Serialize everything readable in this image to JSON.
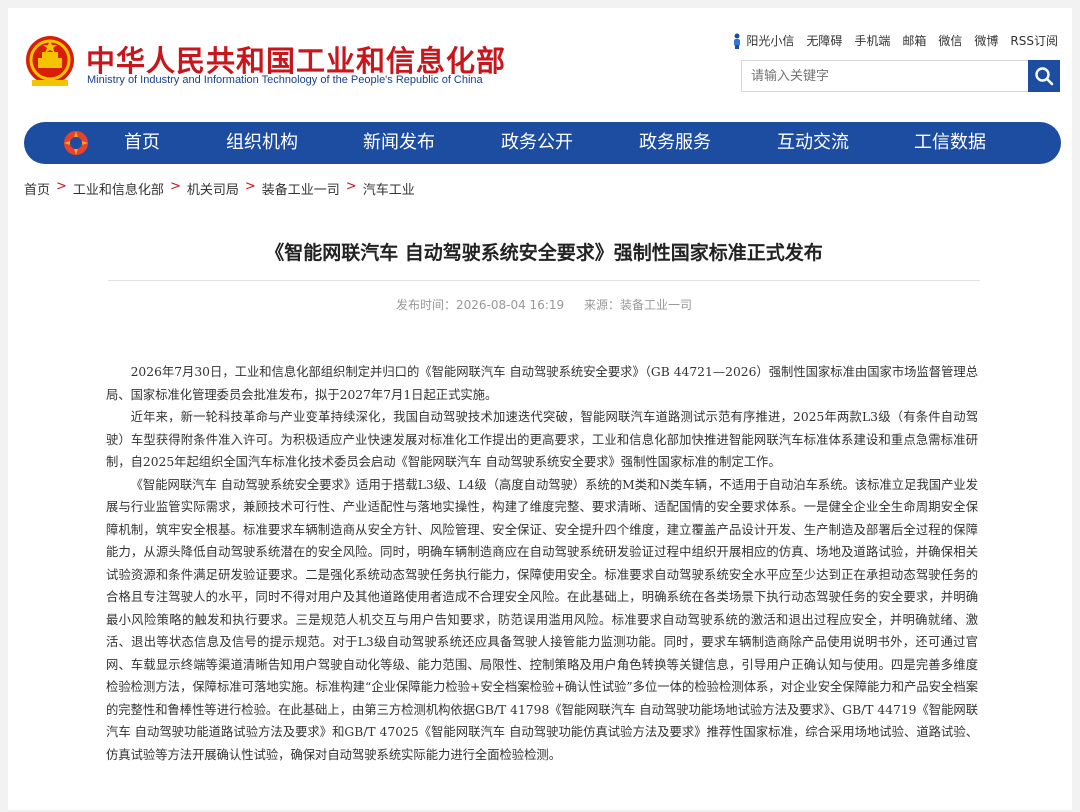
{
  "header": {
    "brand_cn": "中华人民共和国工业和信息化部",
    "brand_en": "Ministry of Industry and Information Technology of the People's Republic of China",
    "toplinks": [
      "阳光小信",
      "无障碍",
      "手机端",
      "邮箱",
      "微信",
      "微博",
      "RSS订阅"
    ],
    "search_placeholder": "请输入关键字"
  },
  "nav": {
    "items": [
      "首页",
      "组织机构",
      "新闻发布",
      "政务公开",
      "政务服务",
      "互动交流",
      "工信数据"
    ]
  },
  "breadcrumb": {
    "items": [
      "首页",
      "工业和信息化部",
      "机关司局",
      "装备工业一司",
      "汽车工业"
    ],
    "separator": ">"
  },
  "article": {
    "title": "《智能网联汽车 自动驾驶系统安全要求》强制性国家标准正式发布",
    "publish_time": "发布时间：2026-08-04 16:19",
    "source": "来源：装备工业一司",
    "paragraphs": [
      "2026年7月30日，工业和信息化部组织制定并归口的《智能网联汽车 自动驾驶系统安全要求》（GB 44721—2026）强制性国家标准由国家市场监督管理总局、国家标准化管理委员会批准发布，拟于2027年7月1日起正式实施。",
      "近年来，新一轮科技革命与产业变革持续深化，我国自动驾驶技术加速迭代突破，智能网联汽车道路测试示范有序推进，2025年两款L3级（有条件自动驾驶）车型获得附条件准入许可。为积极适应产业快速发展对标准化工作提出的更高要求，工业和信息化部加快推进智能网联汽车标准体系建设和重点急需标准研制，自2025年起组织全国汽车标准化技术委员会启动《智能网联汽车 自动驾驶系统安全要求》强制性国家标准的制定工作。",
      "《智能网联汽车 自动驾驶系统安全要求》适用于搭载L3级、L4级（高度自动驾驶）系统的M类和N类车辆，不适用于自动泊车系统。该标准立足我国产业发展与行业监管实际需求，兼顾技术可行性、产业适配性与落地实操性，构建了维度完整、要求清晰、适配国情的安全要求体系。一是健全企业全生命周期安全保障机制，筑牢安全根基。标准要求车辆制造商从安全方针、风险管理、安全保证、安全提升四个维度，建立覆盖产品设计开发、生产制造及部署后全过程的保障能力，从源头降低自动驾驶系统潜在的安全风险。同时，明确车辆制造商应在自动驾驶系统研发验证过程中组织开展相应的仿真、场地及道路试验，并确保相关试验资源和条件满足研发验证要求。二是强化系统动态驾驶任务执行能力，保障使用安全。标准要求自动驾驶系统安全水平应至少达到正在承担动态驾驶任务的合格且专注驾驶人的水平，同时不得对用户及其他道路使用者造成不合理安全风险。在此基础上，明确系统在各类场景下执行动态驾驶任务的安全要求，并明确最小风险策略的触发和执行要求。三是规范人机交互与用户告知要求，防范误用滥用风险。标准要求自动驾驶系统的激活和退出过程应安全，并明确就绪、激活、退出等状态信息及信号的提示规范。对于L3级自动驾驶系统还应具备驾驶人接管能力监测功能。同时，要求车辆制造商除产品使用说明书外，还可通过官网、车载显示终端等渠道清晰告知用户驾驶自动化等级、能力范围、局限性、控制策略及用户角色转换等关键信息，引导用户正确认知与使用。四是完善多维度检验检测方法，保障标准可落地实施。标准构建“企业保障能力检验+安全档案检验+确认性试验”多位一体的检验检测体系，对企业安全保障能力和产品安全档案的完整性和鲁棒性等进行检验。在此基础上，由第三方检测机构依据GB/T 41798《智能网联汽车 自动驾驶功能场地试验方法及要求》、GB/T 44719《智能网联汽车 自动驾驶功能道路试验方法及要求》和GB/T 47025《智能网联汽车 自动驾驶功能仿真试验方法及要求》推荐性国家标准，综合采用场地试验、道路试验、仿真试验等方法开展确认性试验，确保对自动驾驶系统实际能力进行全面检验检测。"
    ]
  },
  "colors": {
    "brand_red": "#c8161d",
    "nav_blue": "#1d4da1",
    "breadcrumb_sep": "#c8161d"
  },
  "icons": {
    "emblem": "national-emblem-icon",
    "search": "search-icon",
    "nav_logo": "miit-logo-icon",
    "toplink_person": "person-icon"
  }
}
